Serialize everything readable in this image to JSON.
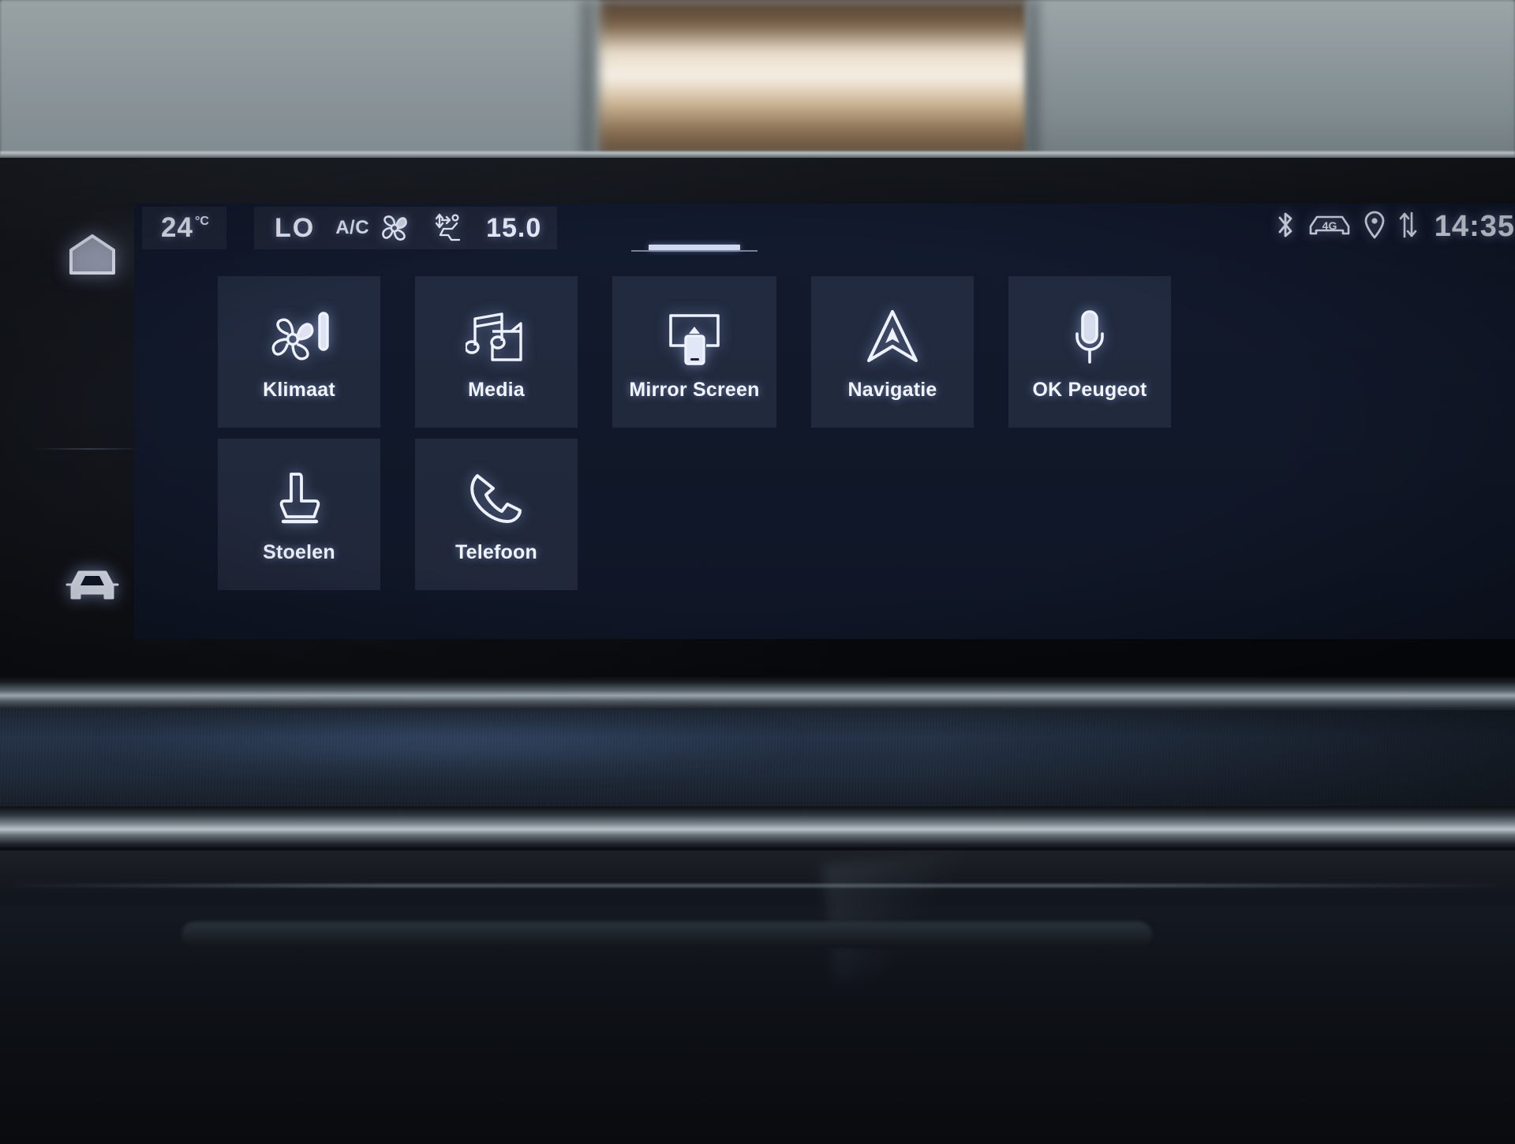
{
  "statusbar": {
    "climate": {
      "driver_temp": "24",
      "driver_temp_unit": "°C",
      "passenger_temp": "LO",
      "ac_label": "A/C",
      "fan_icon": "fan-icon",
      "airflow_icon": "airflow-seat-icon",
      "fan_speed": "15.0"
    },
    "system": {
      "bluetooth_icon": "bluetooth-icon",
      "network_label": "4G",
      "network_icon": "car-4g-icon",
      "location_icon": "location-pin-icon",
      "data_transfer_icon": "up-down-arrows-icon",
      "clock": "14:35"
    },
    "drag_handle": "drag-handle"
  },
  "rail": {
    "home": {
      "label": "Home",
      "icon": "home-icon"
    },
    "vehicle": {
      "label": "Vehicle",
      "icon": "car-icon"
    }
  },
  "tiles": {
    "row1": [
      {
        "label": "Klimaat",
        "icon": "fan-thermometer-icon"
      },
      {
        "label": "Media",
        "icon": "music-note-icon"
      },
      {
        "label": "Mirror Screen",
        "icon": "screen-mirroring-icon"
      },
      {
        "label": "Navigatie",
        "icon": "navigation-arrow-icon"
      },
      {
        "label": "OK Peugeot",
        "icon": "microphone-icon"
      }
    ],
    "row2": [
      {
        "label": "Stoelen",
        "icon": "seat-icon"
      },
      {
        "label": "Telefoon",
        "icon": "phone-handset-icon"
      }
    ]
  },
  "colors": {
    "screen_bg": "#111829",
    "tile_bg": "rgba(160,175,215,0.115)",
    "text": "#f1f4fd",
    "glow": "#aac3ff"
  }
}
